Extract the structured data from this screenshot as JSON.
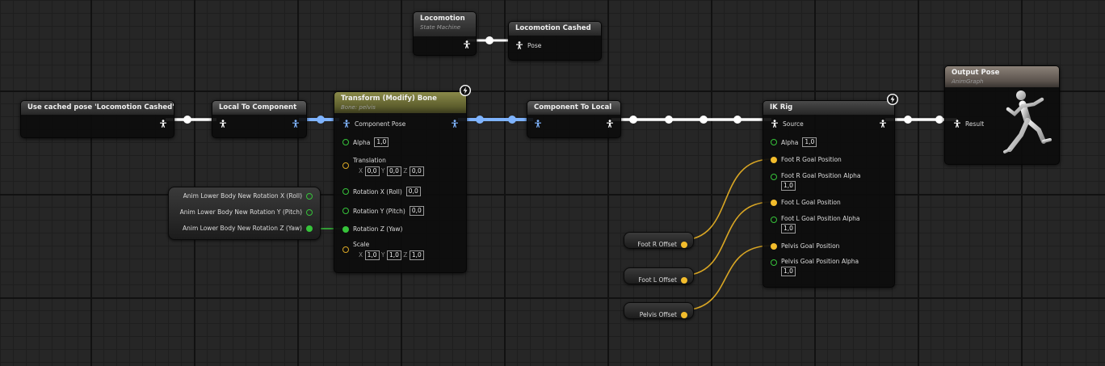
{
  "nodes": {
    "locomotion": {
      "title": "Locomotion",
      "subtitle": "State Machine"
    },
    "locomotion_cashed": {
      "title": "Locomotion Cashed",
      "pose_label": "Pose"
    },
    "use_cached": {
      "title": "Use cached pose 'Locomotion Cashed'"
    },
    "local_to_component": {
      "title": "Local To Component"
    },
    "transform_bone": {
      "title": "Transform (Modify) Bone",
      "subtitle": "Bone: pelvis",
      "component_pose": "Component Pose",
      "alpha_label": "Alpha",
      "alpha_value": "1,0",
      "translation_label": "Translation",
      "translation": {
        "x": "0,0",
        "y": "0,0",
        "z": "0,0"
      },
      "rot_x_label": "Rotation X (Roll)",
      "rot_x_value": "0,0",
      "rot_y_label": "Rotation Y (Pitch)",
      "rot_y_value": "0,0",
      "rot_z_label": "Rotation Z (Yaw)",
      "scale_label": "Scale",
      "scale": {
        "x": "1,0",
        "y": "1,0",
        "z": "1,0"
      },
      "axis_x": "X",
      "axis_y": "Y",
      "axis_z": "Z"
    },
    "component_to_local": {
      "title": "Component To Local"
    },
    "ik_rig": {
      "title": "IK Rig",
      "source_label": "Source",
      "alpha_label": "Alpha",
      "alpha_value": "1,0",
      "foot_r_goal": "Foot R Goal Position",
      "foot_r_alpha": "Foot R Goal Position Alpha",
      "foot_r_alpha_value": "1,0",
      "foot_l_goal": "Foot L Goal Position",
      "foot_l_alpha": "Foot L Goal Position Alpha",
      "foot_l_alpha_value": "1,0",
      "pelvis_goal": "Pelvis Goal Position",
      "pelvis_alpha": "Pelvis Goal Position Alpha",
      "pelvis_alpha_value": "1,0"
    },
    "output_pose": {
      "title": "Output Pose",
      "subtitle": "AnimGraph",
      "result_label": "Result"
    }
  },
  "variables": {
    "rot_x": "Anim Lower Body New Rotation X (Roll)",
    "rot_y": "Anim Lower Body New Rotation Y (Pitch)",
    "rot_z": "Anim Lower Body New Rotation Z (Yaw)",
    "foot_r_offset": "Foot R Offset",
    "foot_l_offset": "Foot L Offset",
    "pelvis_offset": "Pelvis Offset"
  },
  "colors": {
    "pose_wire_local": "#ffffff",
    "pose_wire_component": "#7fb4ff",
    "float_pin": "#36c33a",
    "vector_pin": "#f2bc2c",
    "graph_background": "#262626"
  },
  "icons": {
    "pose_pin": "pose-person-icon",
    "component_pose_pin": "component-pose-person-icon",
    "fast_path": "lightning-bolt-icon",
    "output_preview": "running-mannequin-icon"
  }
}
